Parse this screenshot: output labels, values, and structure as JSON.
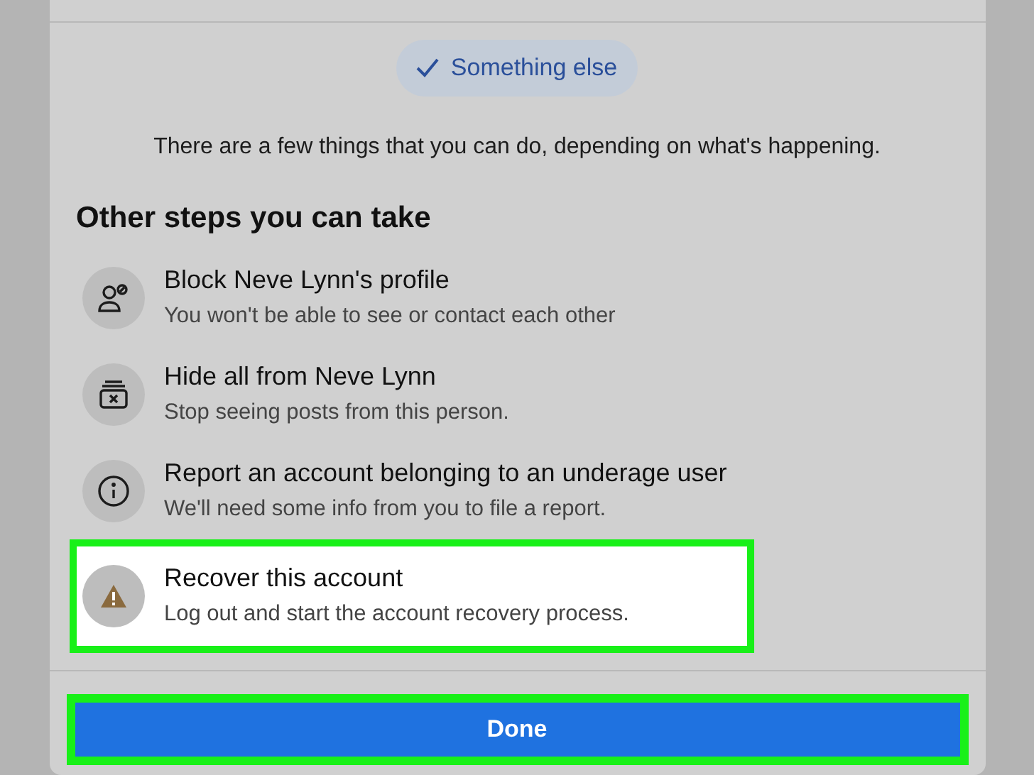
{
  "chip": {
    "label": "Something else",
    "checked": true
  },
  "intro": "There are a few things that you can do, depending on what's happening.",
  "section_title": "Other steps you can take",
  "options": [
    {
      "kind": "block",
      "title": "Block Neve Lynn's profile",
      "subtitle": "You won't be able to see or contact each other",
      "highlighted": false
    },
    {
      "kind": "hide",
      "title": "Hide all from Neve Lynn",
      "subtitle": "Stop seeing posts from this person.",
      "highlighted": false
    },
    {
      "kind": "info",
      "title": "Report an account belonging to an underage user",
      "subtitle": "We'll need some info from you to file a report.",
      "highlighted": false
    },
    {
      "kind": "warning",
      "title": "Recover this account",
      "subtitle": "Log out and start the account recovery process.",
      "highlighted": true
    }
  ],
  "done_button": {
    "label": "Done",
    "highlighted": true
  }
}
